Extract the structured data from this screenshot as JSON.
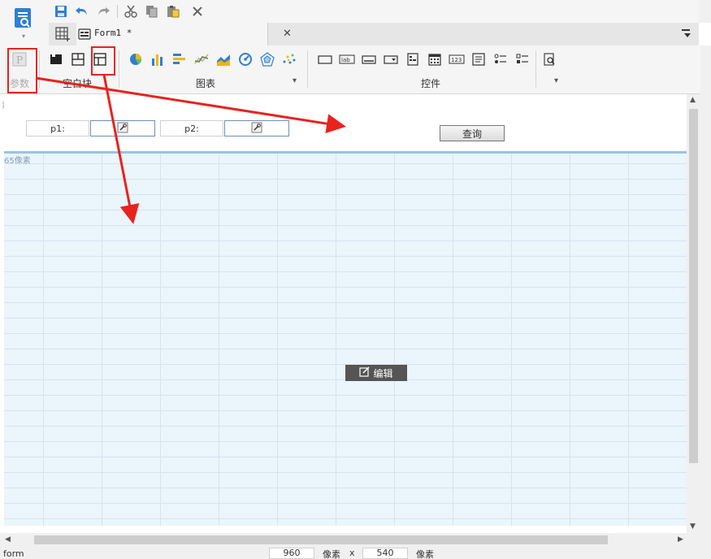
{
  "quick_toolbar": {
    "icons": [
      "save-icon",
      "undo-icon",
      "redo-icon",
      "cut-icon",
      "copy-icon",
      "paste-icon",
      "delete-icon"
    ]
  },
  "tabs": [
    {
      "label": "Form1 *",
      "icon": "form-icon",
      "active": true
    }
  ],
  "ribbon": {
    "groups": [
      {
        "label": "参数",
        "icon": "param-icon"
      },
      {
        "label": "空白块"
      },
      {
        "label": "图表"
      },
      {
        "label": "控件"
      }
    ],
    "blank_block_icons": [
      "block-solid-icon",
      "block-split-icon",
      "block-grid-icon"
    ],
    "chart_icons": [
      "pie-chart-icon",
      "bar-chart-icon",
      "horizontal-bar-chart-icon",
      "line-chart-icon",
      "area-chart-icon",
      "gauge-chart-icon",
      "radar-chart-icon",
      "scatter-chart-icon"
    ],
    "widget_icons": [
      "label-widget-icon",
      "lab-widget-icon",
      "textbox-widget-icon",
      "dropdown-widget-icon",
      "tree-widget-icon",
      "date-widget-icon",
      "number-widget-icon",
      "textarea-widget-icon",
      "radio-group-widget-icon",
      "checkbox-group-widget-icon",
      "search-preview-icon"
    ],
    "lab_text": "lab",
    "num_text": "123"
  },
  "canvas": {
    "top_tag": "素",
    "body_tag": "65像素",
    "params": [
      {
        "label": "p1:"
      },
      {
        "label": "p2:"
      }
    ],
    "query_button": "查询",
    "edit_button": "编辑"
  },
  "status_bar": {
    "left": "form",
    "width": "960",
    "unit1": "像素",
    "times": "x",
    "height": "540",
    "unit2": "像素"
  },
  "colors": {
    "accent_blue": "#2f7fd1",
    "annotation_red": "#e8231d",
    "canvas_grid_bg": "#eaf5fc",
    "divider_blue": "#9cc2e5"
  }
}
